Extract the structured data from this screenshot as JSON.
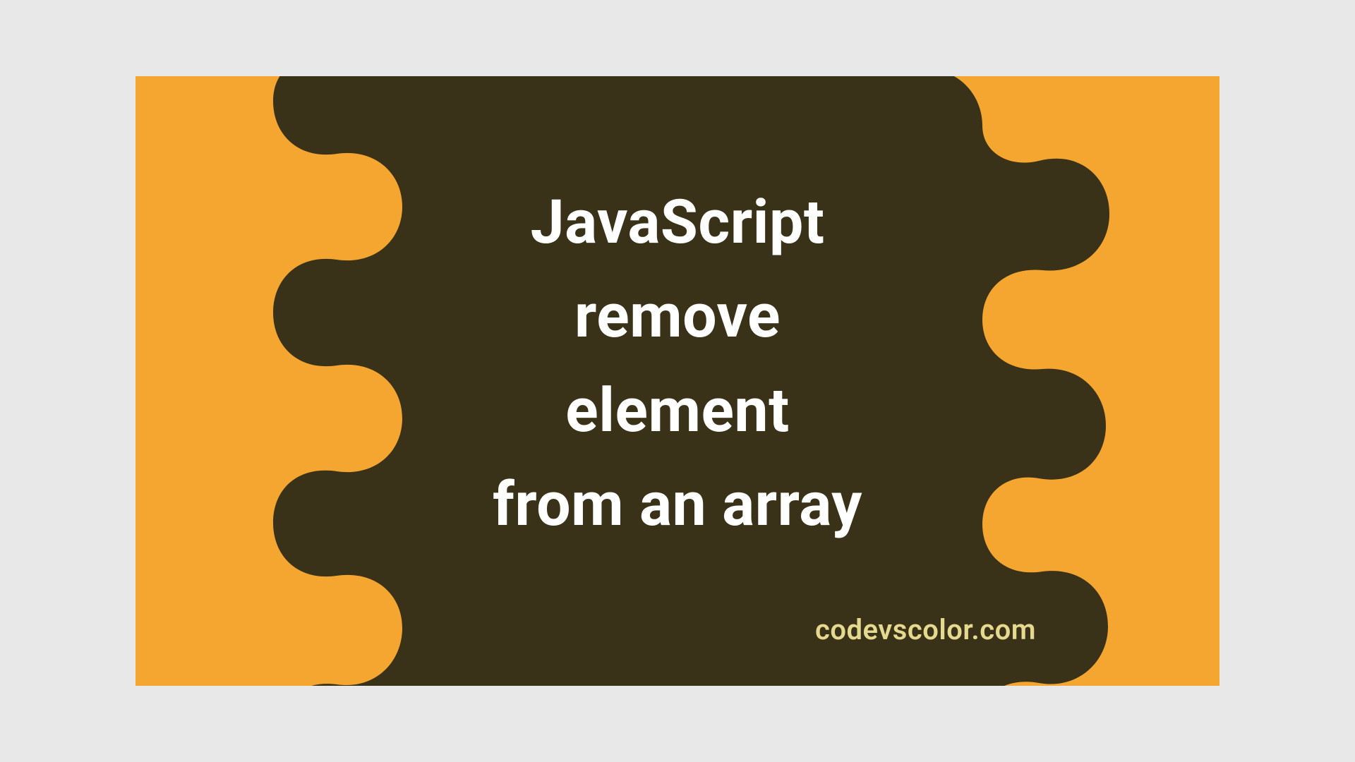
{
  "title": {
    "line1": "JavaScript",
    "line2": "remove",
    "line3": "element",
    "line4": "from an array"
  },
  "watermark": "codevscolor.com",
  "colors": {
    "background": "#f4a631",
    "blob": "#3a3218",
    "text": "#ffffff",
    "watermark": "#e5d88f"
  }
}
